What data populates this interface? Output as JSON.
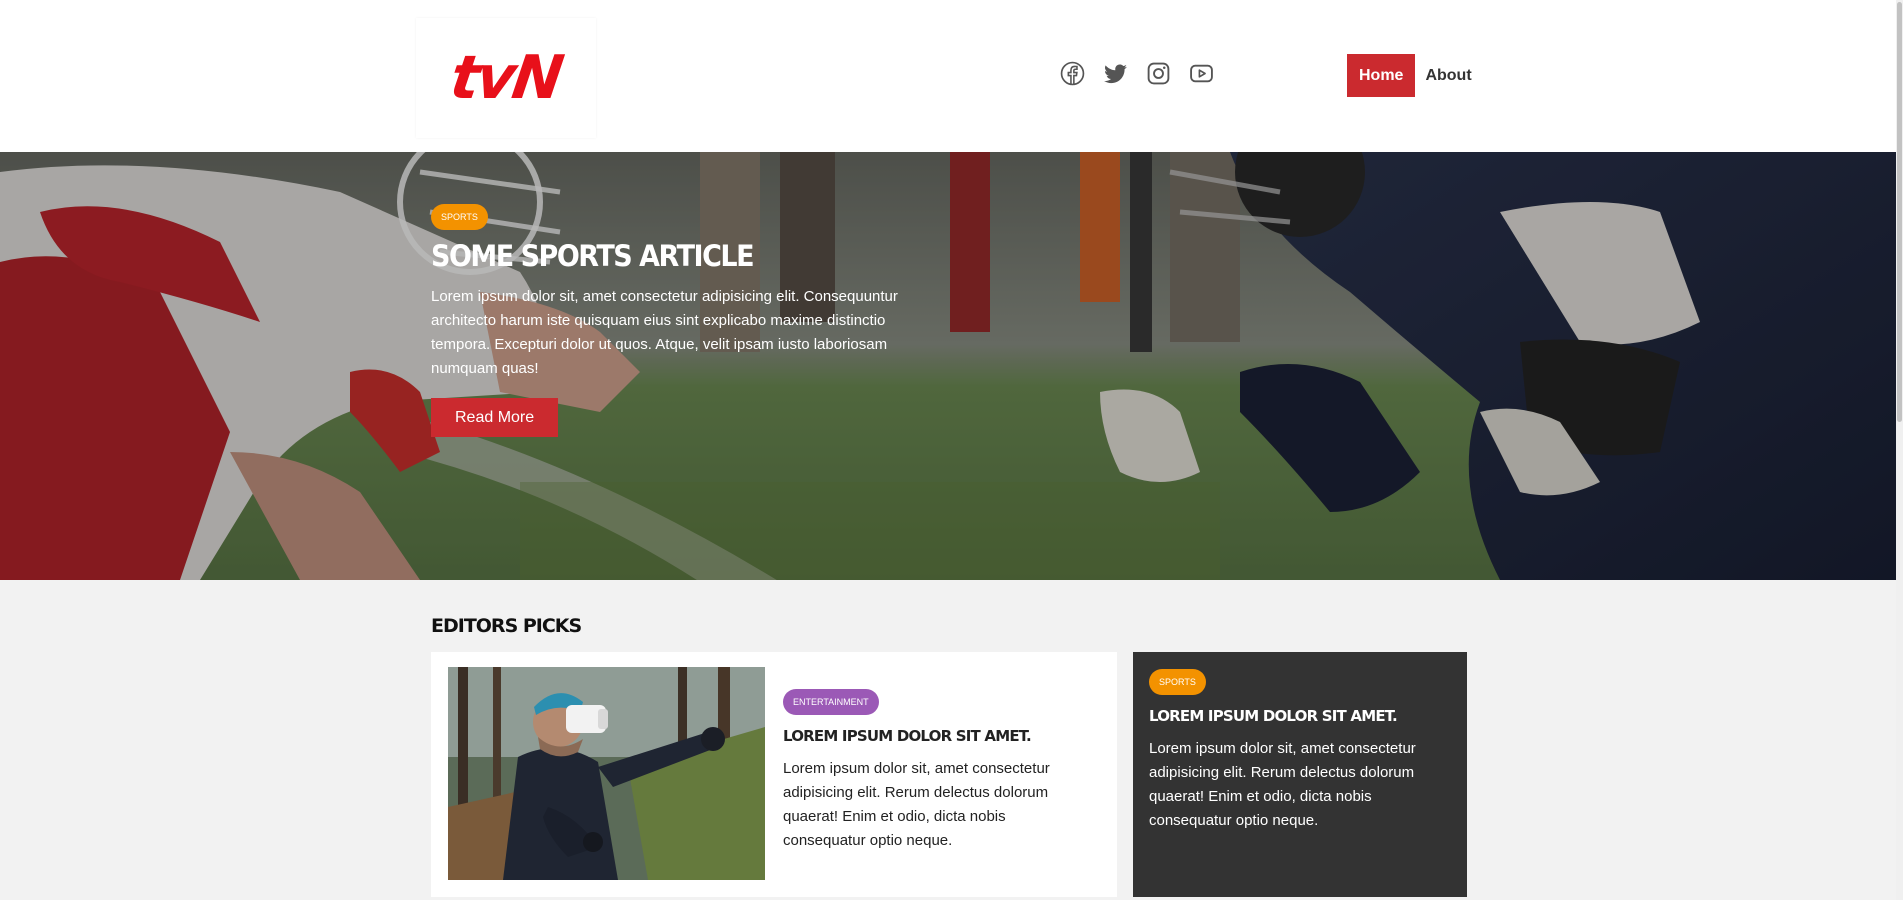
{
  "header": {
    "logo_text": "tvN",
    "social_icons": [
      "facebook-icon",
      "twitter-icon",
      "instagram-icon",
      "youtube-icon"
    ],
    "nav": [
      {
        "label": "Home",
        "active": true
      },
      {
        "label": "About",
        "active": false
      }
    ]
  },
  "hero": {
    "badge": "SPORTS",
    "title": "SOME SPORTS ARTICLE",
    "text": "Lorem ipsum dolor sit, amet consectetur adipisicing elit. Consequuntur architecto harum iste quisquam eius sint explicabo maxime distinctio tempora. Excepturi dolor ut quos. Atque, velit ipsam iusto laboriosam numquam quas!",
    "button": "Read More"
  },
  "editors_picks": {
    "title": "EDITORS PICKS",
    "main_card": {
      "badge": "ENTERTAINMENT",
      "title": "LOREM IPSUM DOLOR SIT AMET.",
      "text": "Lorem ipsum dolor sit, amet consectetur adipisicing elit. Rerum delectus dolorum quaerat! Enim et odio, dicta nobis consequatur optio neque."
    },
    "side_card": {
      "badge": "SPORTS",
      "title": "LOREM IPSUM DOLOR SIT AMET.",
      "text": "Lorem ipsum dolor sit, amet consectetur adipisicing elit. Rerum delectus dolorum quaerat! Enim et odio, dicta nobis consequatur optio neque."
    }
  },
  "colors": {
    "brand_red": "#cb2a2f",
    "logo_red": "#e8101a",
    "sports_badge": "#f39200",
    "entertainment_badge": "#9b59b6",
    "dark_card": "#333333"
  }
}
